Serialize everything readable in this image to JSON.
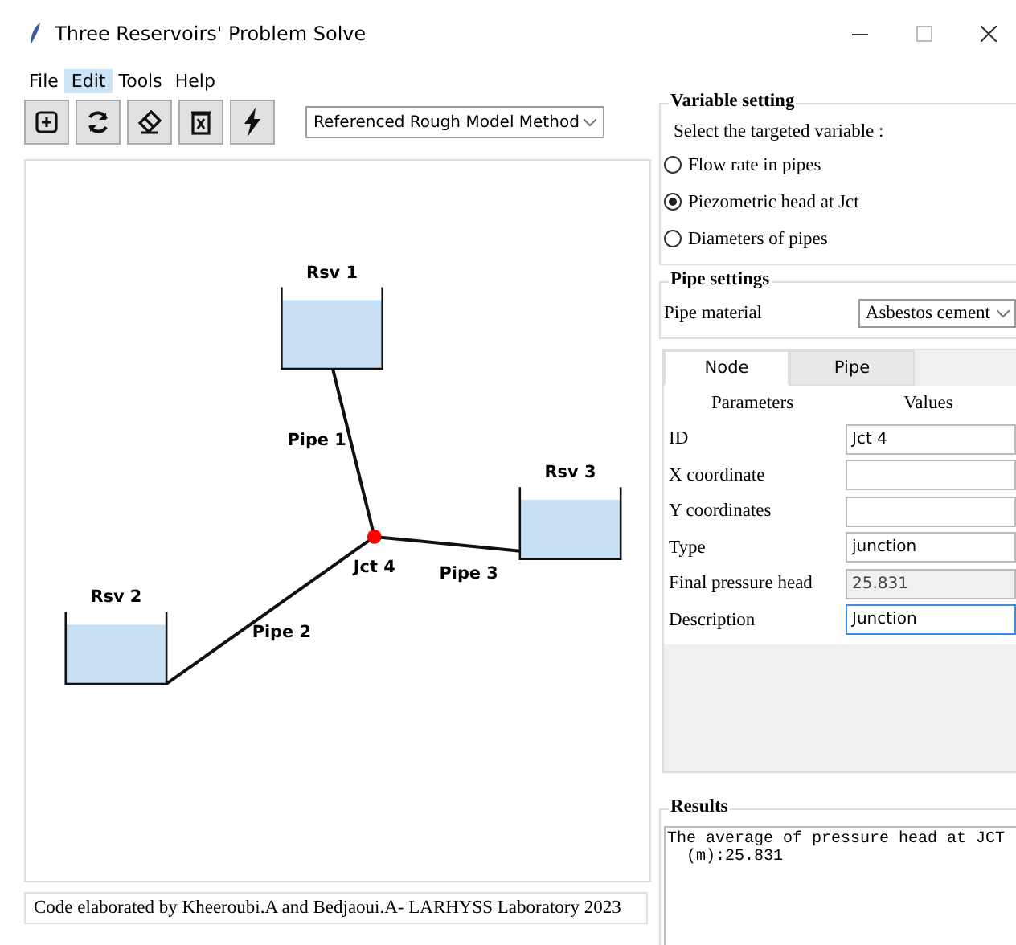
{
  "window": {
    "title": "Three Reservoirs' Problem Solve"
  },
  "menu": [
    {
      "label": "File",
      "selected": false
    },
    {
      "label": "Edit",
      "selected": true
    },
    {
      "label": "Tools",
      "selected": false
    },
    {
      "label": "Help",
      "selected": false
    }
  ],
  "toolbar": {
    "method": "Referenced Rough Model Method"
  },
  "diagram": {
    "reservoirs": [
      {
        "label": "Rsv 1"
      },
      {
        "label": "Rsv 3"
      },
      {
        "label": "Rsv 2"
      }
    ],
    "junction": {
      "label": "Jct 4"
    },
    "pipes": [
      {
        "label": "Pipe 1"
      },
      {
        "label": "Pipe 3"
      },
      {
        "label": "Pipe 2"
      }
    ]
  },
  "status": "Code elaborated by Kheeroubi.A and Bedjaoui.A- LARHYSS Laboratory 2023",
  "variable_setting": {
    "title": "Variable setting",
    "prompt": "Select the targeted variable :",
    "options": [
      {
        "label": "Flow rate in pipes",
        "selected": false
      },
      {
        "label": "Piezometric head at Jct",
        "selected": true
      },
      {
        "label": "Diameters of pipes",
        "selected": false
      }
    ]
  },
  "pipe_settings": {
    "title": "Pipe settings",
    "material_label": "Pipe material",
    "material": "Asbestos cement"
  },
  "tabs": [
    {
      "label": "Node",
      "selected": true
    },
    {
      "label": "Pipe",
      "selected": false
    }
  ],
  "properties": {
    "columns": [
      "Parameters",
      "Values"
    ],
    "rows": [
      {
        "name": "ID",
        "value": "Jct 4",
        "disabled": false,
        "focused": false
      },
      {
        "name": "X coordinate",
        "disabled": false,
        "focused": false
      },
      {
        "name": "Y coordinates",
        "disabled": false,
        "focused": false
      },
      {
        "name": "Type",
        "value": "junction",
        "disabled": false,
        "focused": false
      },
      {
        "name": "Final pressure head",
        "value": "25.831",
        "disabled": true,
        "focused": false
      },
      {
        "name": "Description",
        "value": "Junction",
        "disabled": false,
        "focused": true
      }
    ]
  },
  "results": {
    "title": "Results",
    "lines": [
      "The average of pressure head at JCT",
      "  (m):25.831"
    ]
  }
}
